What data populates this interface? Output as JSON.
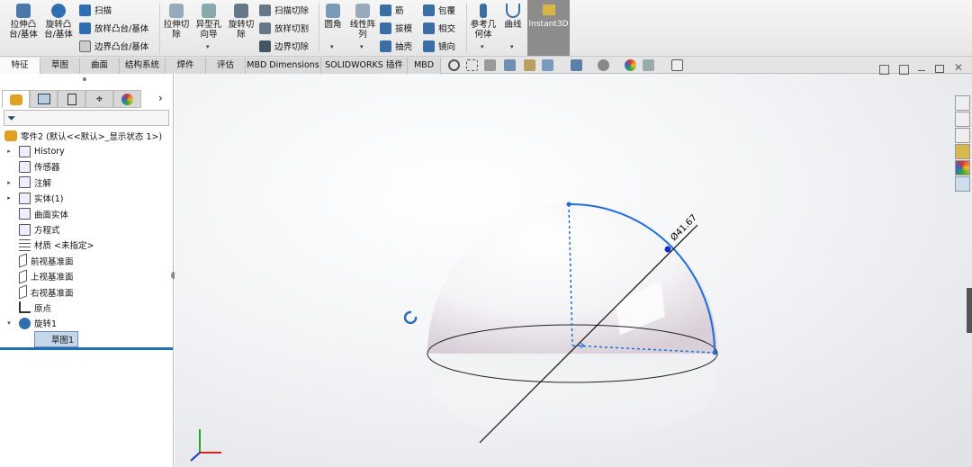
{
  "ribbon": {
    "extrude_boss": "拉伸凸台/基体",
    "revolve_boss": "旋转凸台/基体",
    "sweep": "扫描",
    "loft_boss": "放样凸台/基体",
    "boundary_boss": "边界凸台/基体",
    "extrude_cut": "拉伸切除",
    "hole_wizard": "异型孔向导",
    "revolve_cut": "旋转切除",
    "sweep_cut": "扫描切除",
    "loft_cut": "放样切割",
    "boundary_cut": "边界切除",
    "fillet": "圆角",
    "linear_pattern": "线性阵列",
    "rib": "筋",
    "draft": "拔模",
    "shell": "抽壳",
    "wrap": "包覆",
    "intersect": "相交",
    "mirror": "镜向",
    "ref_geometry": "参考几何体",
    "curves": "曲线",
    "instant3d": "Instant3D"
  },
  "tabs": [
    "特征",
    "草图",
    "曲面",
    "结构系统",
    "焊件",
    "评估",
    "MBD Dimensions",
    "SOLIDWORKS 插件",
    "MBD"
  ],
  "tree": {
    "root": "零件2  (默认<<默认>_显示状态 1>)",
    "items": [
      "History",
      "传感器",
      "注解",
      "实体(1)",
      "曲面实体",
      "方程式",
      "材质 <未指定>",
      "前视基准面",
      "上视基准面",
      "右视基准面",
      "原点",
      "旋转1"
    ],
    "child": "草图1"
  },
  "viewport": {
    "dimension": "Ø41.67"
  },
  "colors": {
    "accent": "#1e6fd9",
    "selection": "#0066cc"
  }
}
